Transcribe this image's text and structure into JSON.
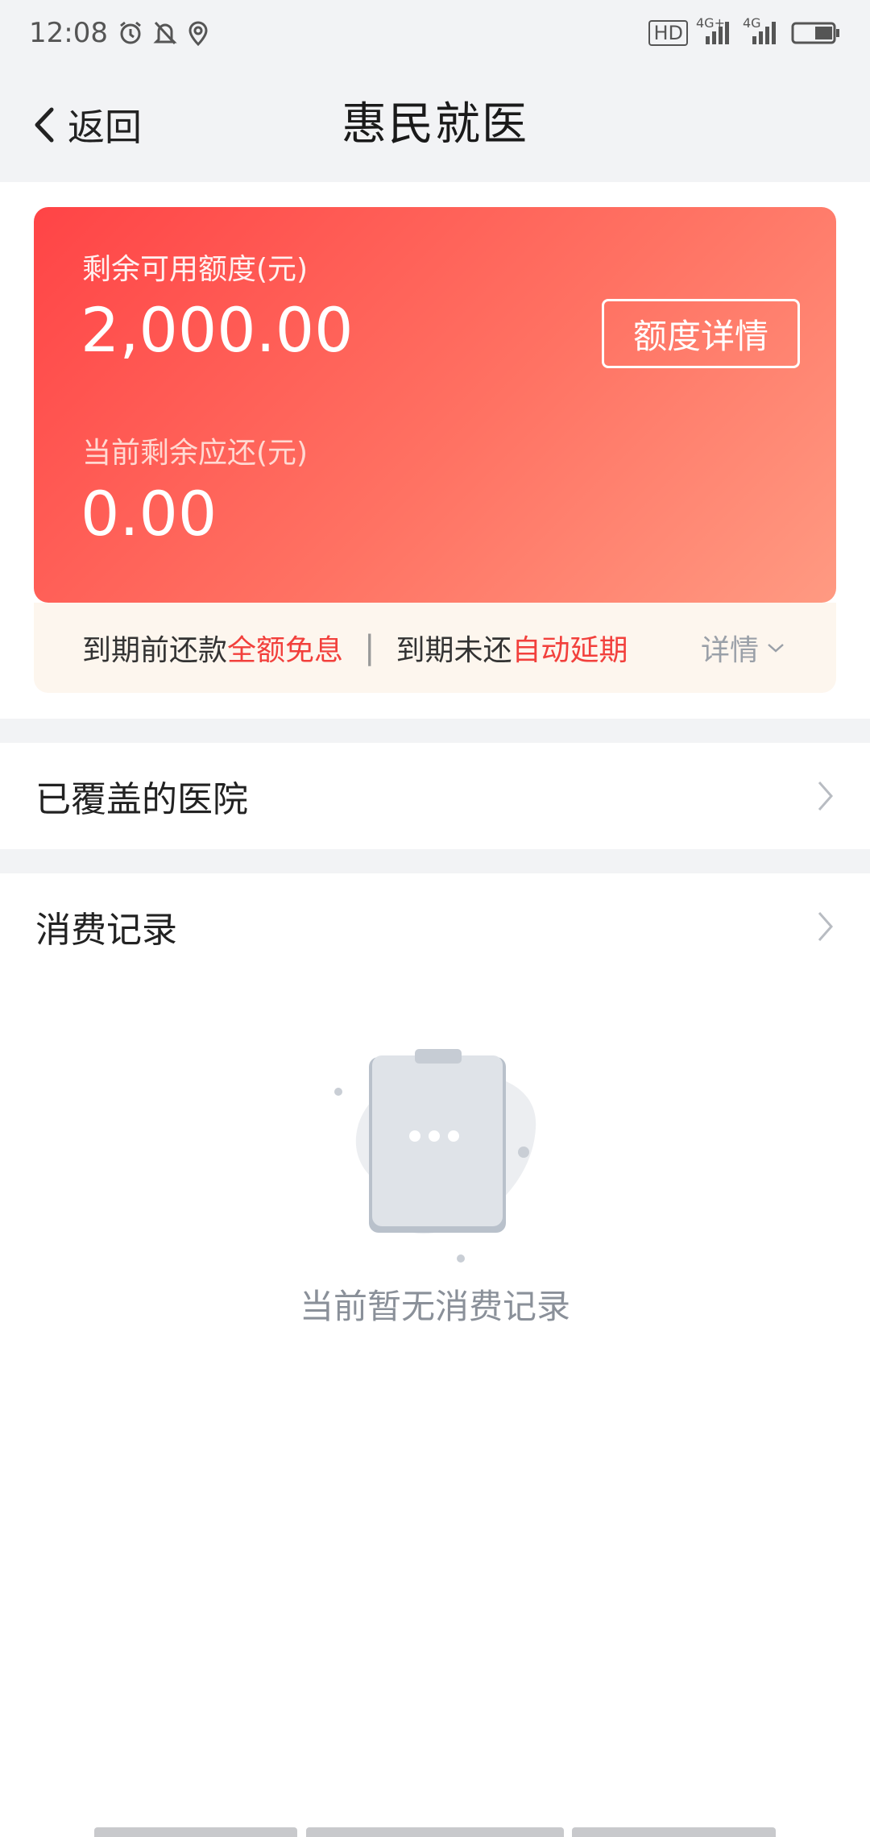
{
  "status_bar": {
    "time": "12:08",
    "icons": [
      "alarm-icon",
      "bell-off-icon",
      "location-icon",
      "hd-icon",
      "signal-4g-plus-icon",
      "signal-4g-icon",
      "battery-icon"
    ],
    "hd_label": "HD",
    "net1_label": "4G+",
    "net2_label": "4G"
  },
  "nav": {
    "back_label": "返回",
    "title": "惠民就医"
  },
  "card": {
    "available_label": "剩余可用额度(元)",
    "available_value": "2,000.00",
    "quota_button": "额度详情",
    "due_label": "当前剩余应还(元)",
    "due_value": "0.00",
    "gradient_colors": [
      "#ff4446",
      "#ff9a82"
    ]
  },
  "tip": {
    "part1": "到期前还款",
    "part1_highlight": "全额免息",
    "separator": "|",
    "part2": "到期未还",
    "part2_highlight": "自动延期",
    "detail": "详情"
  },
  "rows": {
    "hospitals": "已覆盖的医院",
    "records": "消费记录"
  },
  "empty": {
    "text": "当前暂无消费记录"
  },
  "colors": {
    "accent_red": "#f2403c",
    "background_gray": "#f2f3f5"
  }
}
